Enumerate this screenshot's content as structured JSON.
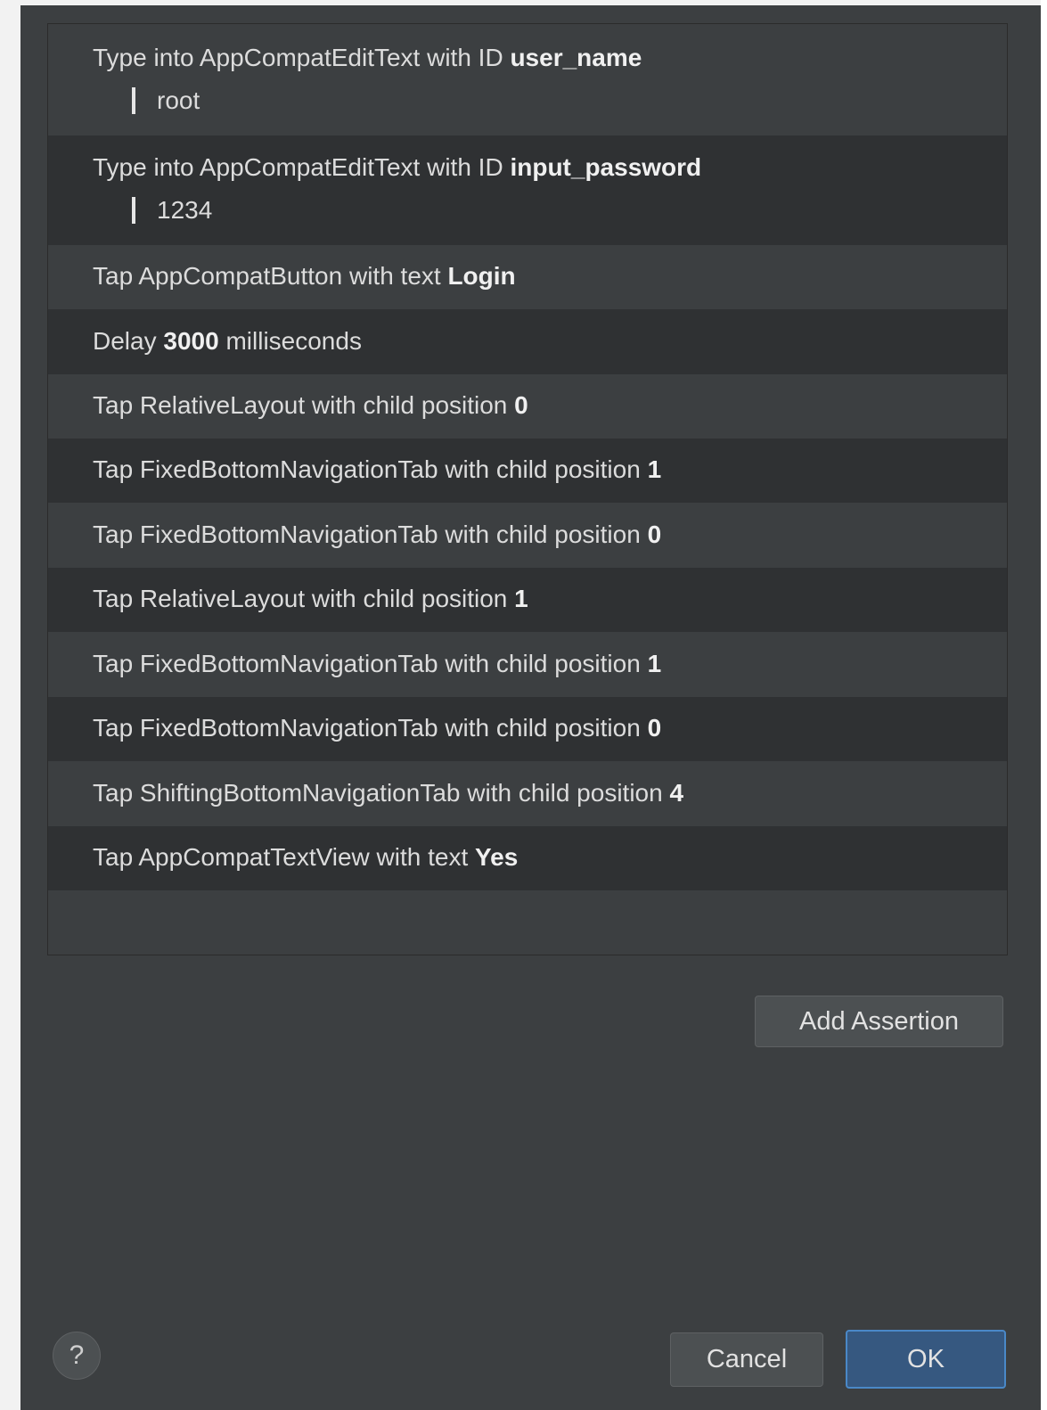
{
  "steps": [
    {
      "prefix": "Type into AppCompatEditText with ID ",
      "value": "user_name",
      "suffix": "",
      "typed": "root"
    },
    {
      "prefix": "Type into AppCompatEditText with ID ",
      "value": "input_password",
      "suffix": "",
      "typed": "1234"
    },
    {
      "prefix": "Tap AppCompatButton with text ",
      "value": "Login",
      "suffix": ""
    },
    {
      "prefix": "Delay ",
      "value": "3000",
      "suffix": " milliseconds"
    },
    {
      "prefix": "Tap RelativeLayout with child position ",
      "value": "0",
      "suffix": ""
    },
    {
      "prefix": "Tap FixedBottomNavigationTab with child position ",
      "value": "1",
      "suffix": ""
    },
    {
      "prefix": "Tap FixedBottomNavigationTab with child position ",
      "value": "0",
      "suffix": ""
    },
    {
      "prefix": "Tap RelativeLayout with child position ",
      "value": "1",
      "suffix": ""
    },
    {
      "prefix": "Tap FixedBottomNavigationTab with child position ",
      "value": "1",
      "suffix": ""
    },
    {
      "prefix": "Tap FixedBottomNavigationTab with child position ",
      "value": "0",
      "suffix": ""
    },
    {
      "prefix": "Tap ShiftingBottomNavigationTab with child position ",
      "value": "4",
      "suffix": ""
    },
    {
      "prefix": "Tap AppCompatTextView with text ",
      "value": "Yes",
      "suffix": ""
    }
  ],
  "buttons": {
    "add_assertion": "Add Assertion",
    "cancel": "Cancel",
    "ok": "OK",
    "help": "?"
  },
  "colors": {
    "dialog_bg": "#3c3f41",
    "row_dark": "#2f3133",
    "primary_button": "#365880"
  }
}
